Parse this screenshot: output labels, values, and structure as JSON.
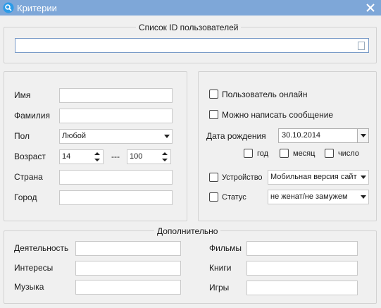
{
  "window": {
    "title": "Критерии",
    "colors": {
      "titlebar": "#7ea7d8",
      "background": "#f0f0f0"
    },
    "icons": {
      "app": "search-icon",
      "close": "close-icon"
    }
  },
  "id_list": {
    "title": "Список ID пользователей",
    "value": ""
  },
  "left": {
    "name_label": "Имя",
    "surname_label": "Фамилия",
    "gender_label": "Пол",
    "gender_value": "Любой",
    "age_label": "Возраст",
    "age_from": "14",
    "age_sep": "---",
    "age_to": "100",
    "country_label": "Страна",
    "city_label": "Город"
  },
  "right": {
    "online_label": "Пользователь онлайн",
    "can_message_label": "Можно написать сообщение",
    "birth_label": "Дата рождения",
    "birth_value": "30.10.2014",
    "year_label": "год",
    "month_label": "месяц",
    "day_label": "число",
    "device_label": "Устройство",
    "device_value": "Мобильная версия сайт",
    "status_label": "Статус",
    "status_value": "не женат/не замужем"
  },
  "extra": {
    "title": "Дополнительно",
    "activity_label": "Деятельность",
    "interests_label": "Интересы",
    "music_label": "Музыка",
    "movies_label": "Фильмы",
    "books_label": "Книги",
    "games_label": "Игры"
  }
}
